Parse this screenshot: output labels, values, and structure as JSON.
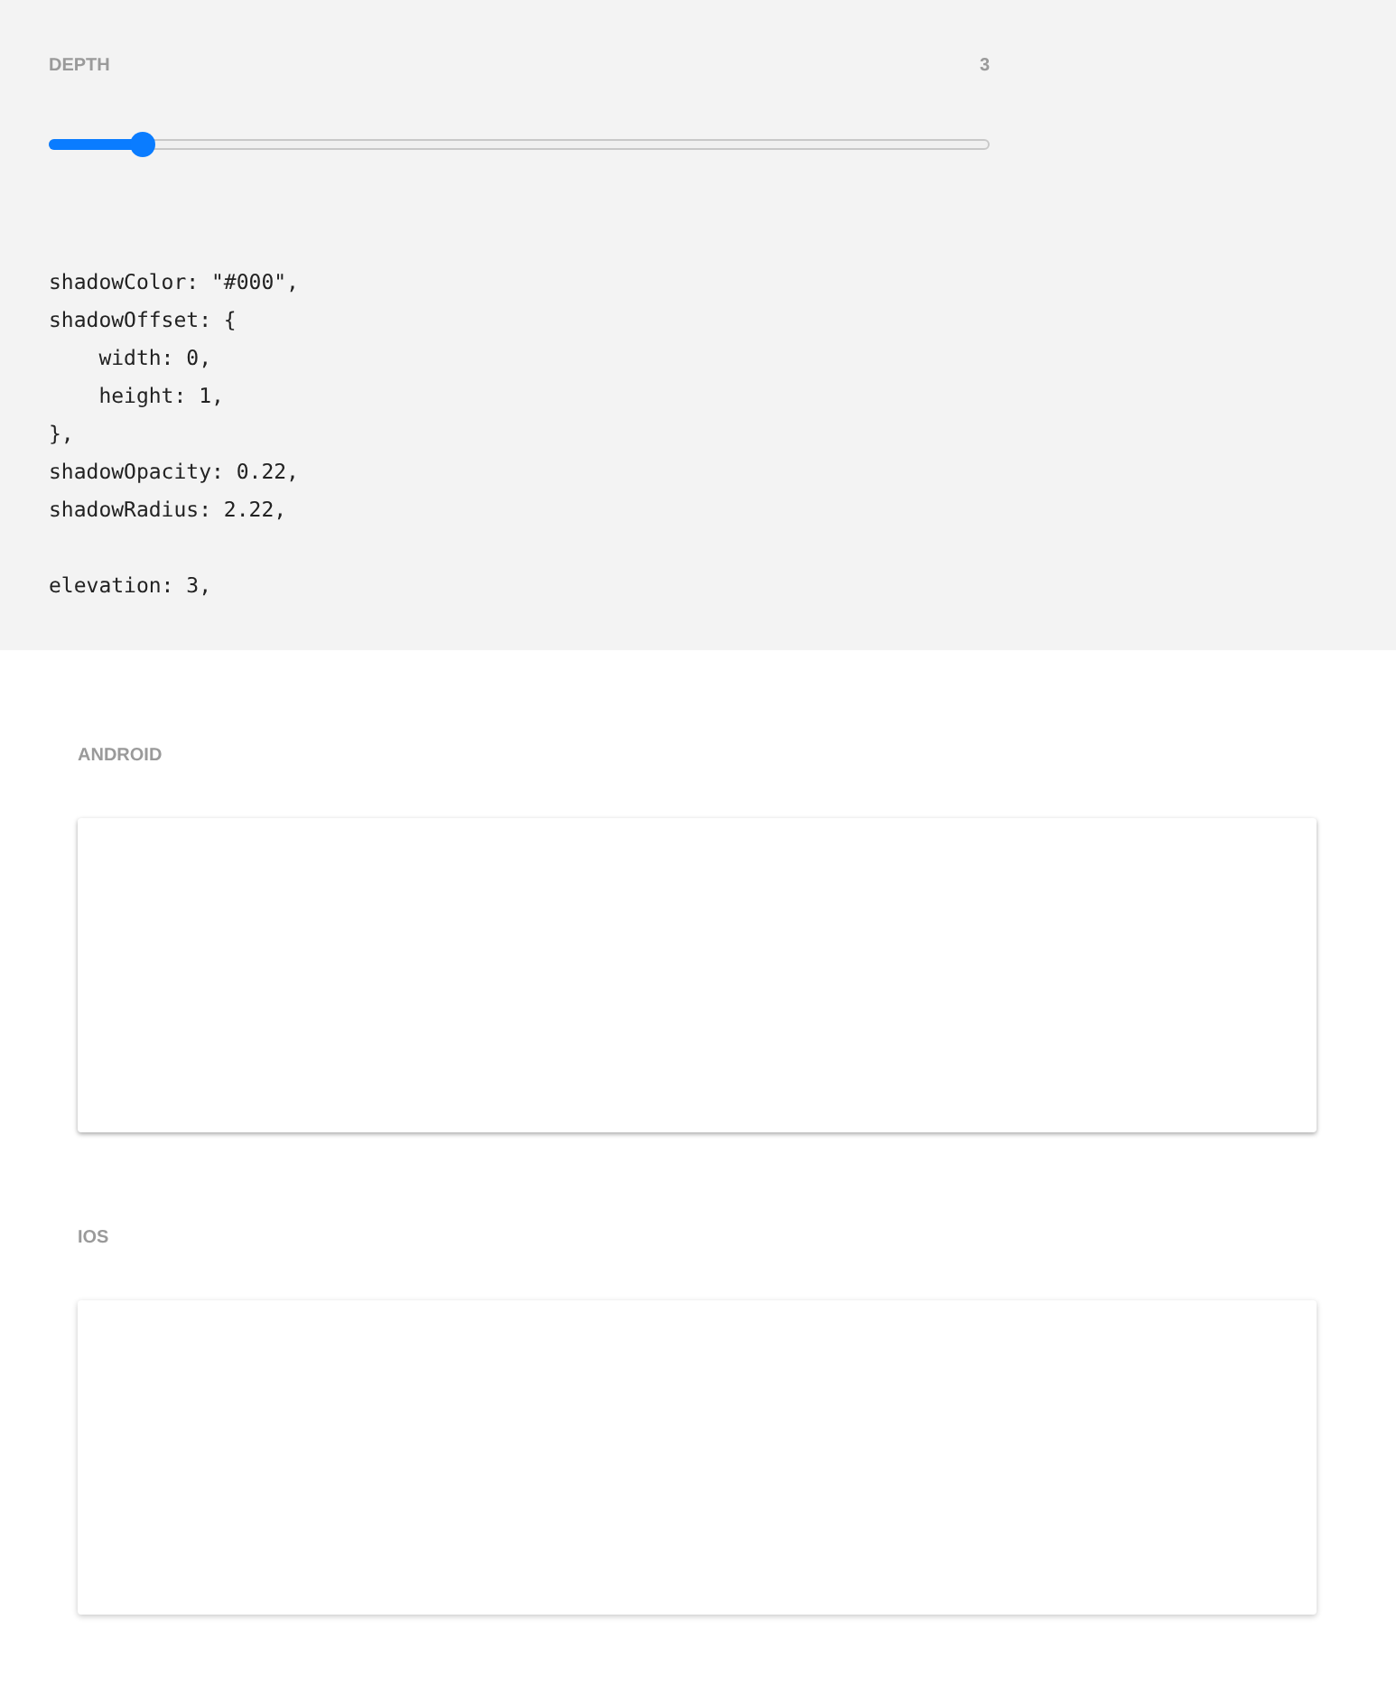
{
  "depth": {
    "label": "DEPTH",
    "value": "3",
    "level": 0.098
  },
  "code_blocks": [
    [
      "shadowColor: \"#000\",",
      "shadowOffset: {",
      "    width: 0,",
      "    height: 1,",
      "},",
      "shadowOpacity: 0.22,",
      "shadowRadius: 2.22,"
    ],
    [
      "elevation: 3,"
    ]
  ],
  "previews": [
    {
      "label": "ANDROID",
      "kind": "android"
    },
    {
      "label": "IOS",
      "kind": "ios"
    }
  ]
}
